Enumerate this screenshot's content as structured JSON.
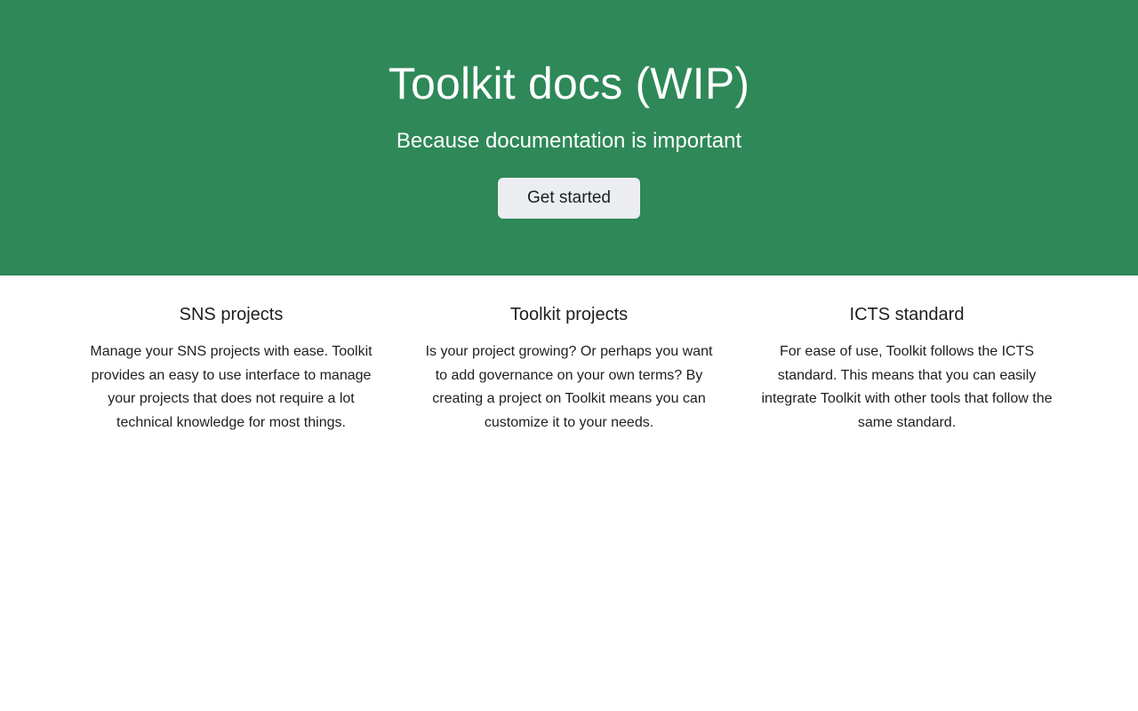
{
  "hero": {
    "title": "Toolkit docs (WIP)",
    "subtitle": "Because documentation is important",
    "cta_label": "Get started",
    "bg_color": "#2e8858"
  },
  "features": [
    {
      "title": "SNS projects",
      "text": "Manage your SNS projects with ease. Toolkit provides an easy to use interface to manage your projects that does not require a lot technical knowledge for most things."
    },
    {
      "title": "Toolkit projects",
      "text": "Is your project growing? Or perhaps you want to add governance on your own terms? By creating a project on Toolkit means you can customize it to your needs."
    },
    {
      "title": "ICTS standard",
      "text": "For ease of use, Toolkit follows the ICTS standard. This means that you can easily integrate Toolkit with other tools that follow the same standard."
    }
  ]
}
